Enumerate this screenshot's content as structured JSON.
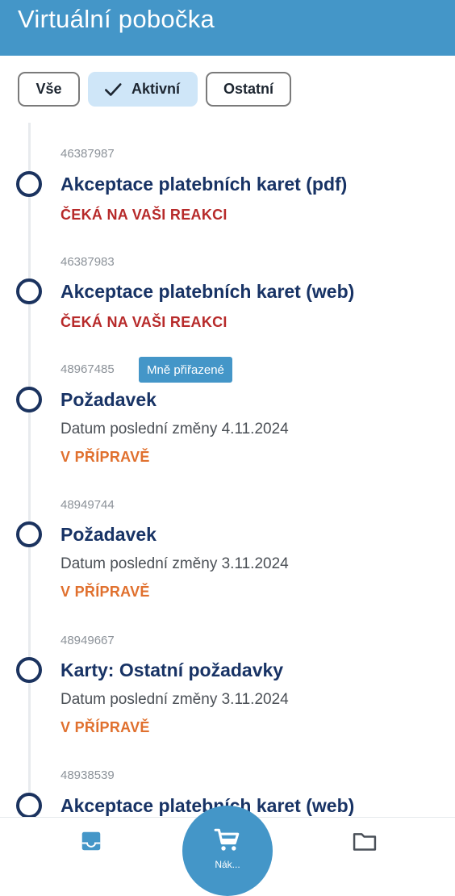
{
  "header": {
    "title": "Virtuální pobočka"
  },
  "filters": {
    "all_label": "Vše",
    "active_label": "Aktivní",
    "other_label": "Ostatní",
    "selected": "Aktivní"
  },
  "items": [
    {
      "id": "46387987",
      "title": "Akceptace platebních karet (pdf)",
      "status": "ČEKÁ NA VAŠI REAKCI"
    },
    {
      "id": "46387983",
      "title": "Akceptace platebních karet (web)",
      "status": "ČEKÁ NA VAŠI REAKCI"
    },
    {
      "id": "48967485",
      "badge": "Mně přiřazené",
      "title": "Požadavek",
      "date": "Datum poslední změny 4.11.2024",
      "status": "V PŘÍPRAVĚ"
    },
    {
      "id": "48949744",
      "title": "Požadavek",
      "date": "Datum poslední změny 3.11.2024",
      "status": "V PŘÍPRAVĚ"
    },
    {
      "id": "48949667",
      "title": "Karty: Ostatní požadavky",
      "date": "Datum poslední změny 3.11.2024",
      "status": "V PŘÍPRAVĚ"
    },
    {
      "id": "48938539",
      "title": "Akceptace platebních karet (web)"
    }
  ],
  "bottom_nav": {
    "items": [
      {
        "icon": "inbox-icon"
      },
      {
        "icon": "cart-icon",
        "label": "Nák..."
      },
      {
        "icon": "folder-icon"
      }
    ]
  },
  "colors": {
    "accent": "#4496c8",
    "title": "#183365",
    "status_waiting": "#b72a2a",
    "status_preparing": "#e0702e",
    "chip_selected_bg": "#cfe6f8"
  }
}
